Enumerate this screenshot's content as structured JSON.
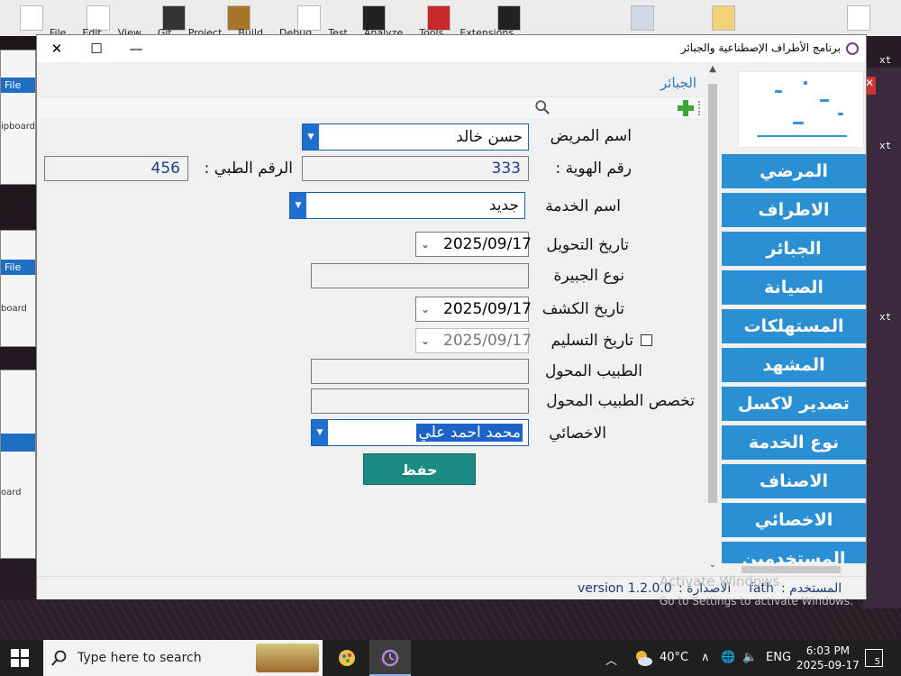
{
  "desktop": {
    "top_menu": [
      "File",
      "Edit",
      "View",
      "Git",
      "Project",
      "Build",
      "Debug",
      "Test",
      "Analyze",
      "Tools",
      "Extensions"
    ],
    "bg_file_label": "File",
    "bg_clipboard_label": "ipboard",
    "bg_clipboard_label2": "board",
    "bg_clipboard_label3": "oard",
    "right_snippet": "xt"
  },
  "window": {
    "title": "برنامج الأطراف الإصطناعية والجبائر",
    "controls": {
      "close": "✕",
      "maximize": "☐",
      "minimize": "—"
    }
  },
  "page": {
    "title": "الجبائر",
    "icons": {
      "search": "search-icon",
      "add": "add-icon"
    }
  },
  "form": {
    "patient_name_label": "اسم المريض",
    "patient_name_value": "حسن خالد",
    "id_label": "رقم الهوية :",
    "id_value": "333",
    "medical_no_label": "الرقم الطبي :",
    "medical_no_value": "456",
    "service_label": "اسم الخدمة",
    "service_value": "جديد",
    "referral_date_label": "تاريخ التحويل",
    "referral_date_value": "2025/09/17",
    "splint_type_label": "نوع الجبيرة",
    "splint_type_value": "",
    "exam_date_label": "تاريخ الكشف",
    "exam_date_value": "2025/09/17",
    "delivery_date_label": "تاريخ التسليم",
    "delivery_date_value": "2025/09/17",
    "referring_doctor_label": "الطبيب المحول",
    "referring_doctor_value": "",
    "doctor_specialty_label": "تخصص الطبيب المحول",
    "doctor_specialty_value": "",
    "specialist_label": "الاخصائي",
    "specialist_value": "محمد احمد علي",
    "save_label": "حفظ"
  },
  "sidebar": {
    "items": [
      {
        "label": "المرضي"
      },
      {
        "label": "الاطراف"
      },
      {
        "label": "الجبائر"
      },
      {
        "label": "الصيانة"
      },
      {
        "label": "المستهلكات"
      },
      {
        "label": "المشهد"
      },
      {
        "label": "تصدير لاكسل"
      },
      {
        "label": "نوع الخدمة"
      },
      {
        "label": "الاصناف"
      },
      {
        "label": "الاخصائي"
      },
      {
        "label": "المستخدمين"
      }
    ]
  },
  "status": {
    "user_label": "المستخدم :",
    "user_value": "fath",
    "version_label": "الاصدارة :",
    "version_value": "version 1.2.0.0"
  },
  "watermark": {
    "line1": "Activate Windows",
    "line2": "Go to Settings to activate Windows."
  },
  "taskbar": {
    "search_placeholder": "Type here to search",
    "temperature": "40°C",
    "language": "ENG",
    "time": "6:03 PM",
    "date": "2025-09-17",
    "notification_count": "5"
  },
  "colors": {
    "accent": "#2a8fd3",
    "save_button": "#1a8a82",
    "title_blue": "#2b7bb9"
  }
}
